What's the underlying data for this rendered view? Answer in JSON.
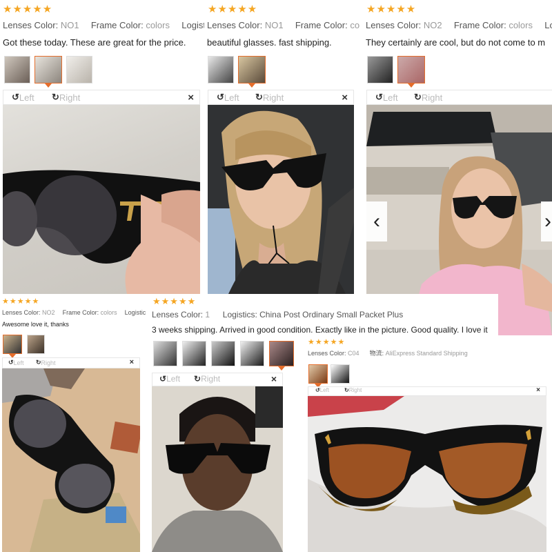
{
  "reviews": [
    {
      "stars": "★★★★★",
      "lenses_label": "Lenses Color:",
      "lenses_value": "NO1",
      "frame_label": "Frame Color:",
      "frame_value": "colors",
      "logistics_label": "Logisti",
      "text": "Got these today. These are great for the price.",
      "rotate_left": "Left",
      "rotate_right": "Right",
      "close": "×"
    },
    {
      "stars": "★★★★★",
      "lenses_label": "Lenses Color:",
      "lenses_value": "NO1",
      "frame_label": "Frame Color:",
      "frame_value": "co",
      "text": "beautiful glasses. fast shipping.",
      "rotate_left": "Left",
      "rotate_right": "Right",
      "close": "×"
    },
    {
      "stars": "★★★★★",
      "lenses_label": "Lenses Color:",
      "lenses_value": "NO2",
      "frame_label": "Frame Color:",
      "frame_value": "colors",
      "logistics_label": "Lo",
      "text": "They certainly are cool, but do not come to m",
      "rotate_left": "Left",
      "rotate_right": "Right",
      "close": "×",
      "prev_arrow": "‹",
      "next_arrow": "›"
    },
    {
      "stars": "★★★★★",
      "lenses_label": "Lenses Color:",
      "lenses_value": "NO2",
      "frame_label": "Frame Color:",
      "frame_value": "colors",
      "logistics_label": "Logistic",
      "text": "Awesome love it, thanks",
      "rotate_left": "Left",
      "rotate_right": "Right",
      "close": "×"
    },
    {
      "stars": "★★★★★",
      "lenses_label": "Lenses Color:",
      "lenses_value": "1",
      "logistics_label": "Logistics:",
      "logistics_value": "China Post Ordinary Small Packet Plus",
      "text": "3 weeks shipping. Arrived in good condition. Exactly like in the picture. Good quality. I love it",
      "rotate_left": "Left",
      "rotate_right": "Right",
      "close": "×"
    },
    {
      "stars": "★★★★★",
      "lenses_label": "Lenses Color:",
      "lenses_value": "C04",
      "logistics_label": "物流:",
      "logistics_value": "AliExpress Standard Shipping",
      "rotate_left": "Left",
      "rotate_right": "Right",
      "close": "×"
    }
  ],
  "colors": {
    "star": "#f5a623",
    "selected_thumb": "#e56d2b"
  }
}
